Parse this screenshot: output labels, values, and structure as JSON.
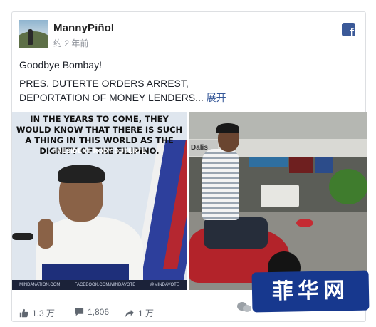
{
  "post": {
    "author": "MannyPiñol",
    "time": "约 2 年前",
    "line1": "Goodbye Bombay!",
    "line2": "PRES. DUTERTE ORDERS ARREST,",
    "line3": "DEPORTATION OF MONEY LENDERS...",
    "more": "展开"
  },
  "images": {
    "left": {
      "quote": "IN THE YEARS TO COME, THEY WOULD KNOW THAT THERE IS SUCH A THING IN THIS WORLD AS THE DIGNITY OF THE FILIPINO.",
      "attribution": "PRESIDENT RODY DUTERTE",
      "footer": [
        "MINDANATION.COM",
        "FACEBOOK.COM/MINDAVOTE",
        "@MINDAVOTE"
      ]
    },
    "right": {
      "sign": "Dalis"
    }
  },
  "stats": {
    "likes": "1.3 万",
    "comments": "1,806",
    "shares": "1 万"
  },
  "watermark": "菲华网",
  "colors": {
    "facebook_blue": "#3b5998",
    "link": "#365899",
    "muted": "#90949c",
    "watermark_bg": "#17388e"
  },
  "icons": {
    "facebook": "facebook-icon",
    "like": "thumbs-up-icon",
    "comment": "comment-icon",
    "share": "share-icon",
    "wechat": "wechat-icon"
  }
}
